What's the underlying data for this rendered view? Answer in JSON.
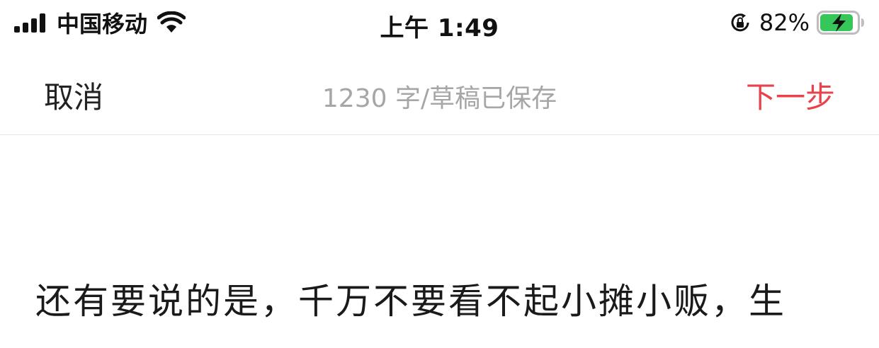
{
  "status_bar": {
    "carrier": "中国移动",
    "time": "上午 1:49",
    "battery_percent": "82%",
    "icons": [
      "signal-icon",
      "wifi-icon",
      "orientation-lock-icon",
      "battery-charging-icon"
    ]
  },
  "nav": {
    "cancel_label": "取消",
    "status_text": "1230 字/草稿已保存",
    "next_label": "下一步"
  },
  "editor": {
    "text": "还有要说的是，千万不要看不起小摊小贩，生"
  },
  "colors": {
    "accent": "#e8424a",
    "status_gray": "#a6a6a6",
    "battery_green": "#35c759"
  }
}
